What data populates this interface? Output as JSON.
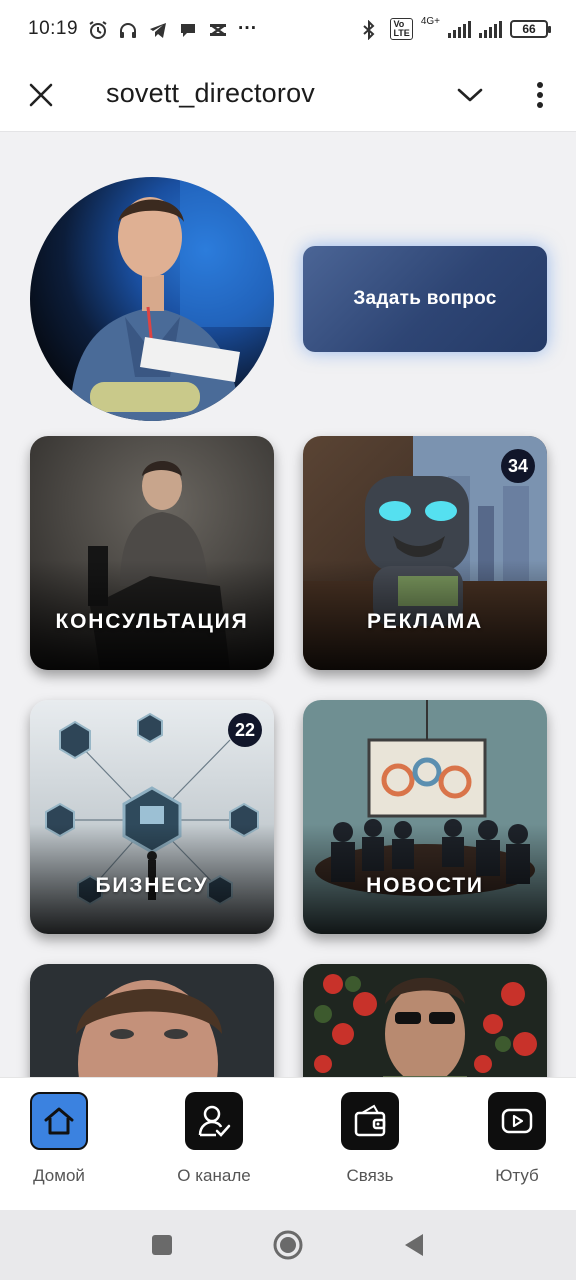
{
  "status_bar": {
    "time": "10:19",
    "network": "4G+",
    "battery": "66",
    "more": "···"
  },
  "header": {
    "title": "sovett_directorov"
  },
  "ask_button": {
    "label": "Задать вопрос"
  },
  "tiles": [
    {
      "label": "КОНСУЛЬТАЦИЯ",
      "badge": ""
    },
    {
      "label": "РЕКЛАМА",
      "badge": "34"
    },
    {
      "label": "БИЗНЕСУ",
      "badge": "22"
    },
    {
      "label": "НОВОСТИ",
      "badge": ""
    }
  ],
  "bottom_nav": [
    {
      "label": "Домой",
      "icon": "home-icon",
      "active": true
    },
    {
      "label": "О канале",
      "icon": "user-check-icon",
      "active": false
    },
    {
      "label": "Связь",
      "icon": "wallet-icon",
      "active": false
    },
    {
      "label": "Ютуб",
      "icon": "youtube-icon",
      "active": false
    }
  ],
  "colors": {
    "accent": "#3b82e0",
    "ask_button": "#2e4574",
    "badge": "#11162a"
  }
}
